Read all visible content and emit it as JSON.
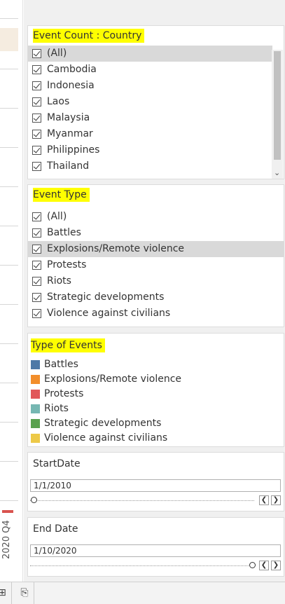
{
  "left_axis": {
    "period_label": "2020 Q4"
  },
  "country_filter": {
    "title": "Event Count : Country",
    "items": [
      "(All)",
      "Cambodia",
      "Indonesia",
      "Laos",
      "Malaysia",
      "Myanmar",
      "Philippines",
      "Thailand"
    ]
  },
  "event_type_filter": {
    "title": "Event Type",
    "items": [
      "(All)",
      "Battles",
      "Explosions/Remote violence",
      "Protests",
      "Riots",
      "Strategic developments",
      "Violence against civilians"
    ]
  },
  "legend": {
    "title": "Type of Events",
    "items": [
      {
        "label": "Battles",
        "color": "#4e79a7"
      },
      {
        "label": "Explosions/Remote violence",
        "color": "#f28e2b"
      },
      {
        "label": "Protests",
        "color": "#e15759"
      },
      {
        "label": "Riots",
        "color": "#76b7b2"
      },
      {
        "label": "Strategic developments",
        "color": "#59a14f"
      },
      {
        "label": "Violence against civilians",
        "color": "#edc948"
      }
    ]
  },
  "start_date": {
    "title": "StartDate",
    "value": "1/1/2010"
  },
  "end_date": {
    "title": "End Date",
    "value": "1/10/2020"
  },
  "bottom_bar": {
    "icons": [
      "new-dashboard-icon",
      "new-story-icon"
    ]
  }
}
